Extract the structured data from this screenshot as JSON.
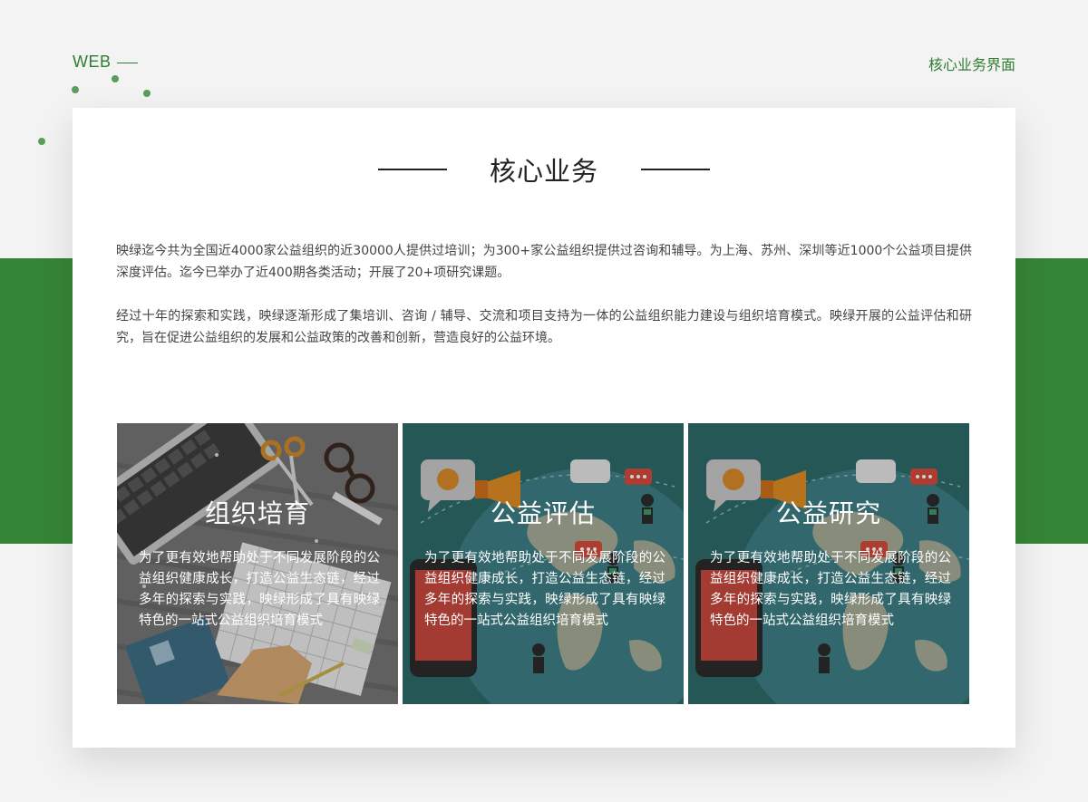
{
  "header": {
    "web_label": "WEB",
    "page_name": "核心业务界面"
  },
  "section": {
    "title": "核心业务"
  },
  "intro": {
    "paragraph1": "映绿迄今共为全国近4000家公益组织的近30000人提供过培训；为300+家公益组织提供过咨询和辅导。为上海、苏州、深圳等近1000个公益项目提供深度评估。迄今已举办了近400期各类活动；开展了20+项研究课题。",
    "paragraph2": "经过十年的探索和实践，映绿逐渐形成了集培训、咨询 / 辅导、交流和项目支持为一体的公益组织能力建设与组织培育模式。映绿开展的公益评估和研究，旨在促进公益组织的发展和公益政策的改善和创新，营造良好的公益环境。"
  },
  "tiles": [
    {
      "title": "组织培育",
      "description": "为了更有效地帮助处于不同发展阶段的公益组织健康成长，打造公益生态链，经过多年的探索与实践，映绿形成了具有映绿特色的一站式公益组织培育模式"
    },
    {
      "title": "公益评估",
      "description": "为了更有效地帮助处于不同发展阶段的公益组织健康成长，打造公益生态链，经过多年的探索与实践，映绿形成了具有映绿特色的一站式公益组织培育模式"
    },
    {
      "title": "公益研究",
      "description": "为了更有效地帮助处于不同发展阶段的公益组织健康成长，打造公益生态链，经过多年的探索与实践，映绿形成了具有映绿特色的一站式公益组织培育模式"
    }
  ],
  "colors": {
    "brand_green": "#358536",
    "accent_green": "#2f7d32",
    "tile_teal": "#2d6b6a",
    "tile_grey": "#6f6f6f"
  }
}
